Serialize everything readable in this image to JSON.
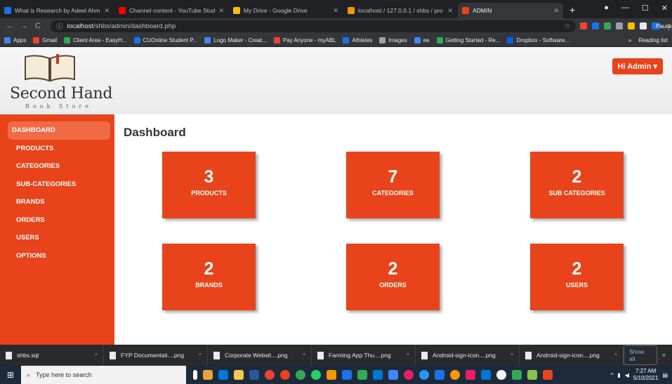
{
  "browser": {
    "tabs": [
      {
        "label": "What is Research by Adeel Ahm",
        "color": "#1a73e8"
      },
      {
        "label": "Channel content - YouTube Stud",
        "color": "#ff0000"
      },
      {
        "label": "My Drive - Google Drive",
        "color": "#fbbc04"
      },
      {
        "label": "localhost / 127.0.0.1 / shbs / pro",
        "color": "#f29900"
      },
      {
        "label": "ADMIN",
        "color": "#e8431a",
        "active": true
      }
    ],
    "new_tab": "+",
    "url_host": "localhost",
    "url_path": "/shbs/admin/dashboard.php",
    "profile_status": "Paused",
    "bookmarks": [
      {
        "label": "Apps",
        "color": "#4285f4"
      },
      {
        "label": "Gmail",
        "color": "#ea4335"
      },
      {
        "label": "Client Area - EasyH...",
        "color": "#34a853"
      },
      {
        "label": "CUOnline Student P...",
        "color": "#1a73e8"
      },
      {
        "label": "Logo Maker - Creat...",
        "color": "#4285f4"
      },
      {
        "label": "Pay Anyone - myABL",
        "color": "#ea4335"
      },
      {
        "label": "Athletes",
        "color": "#1a73e8"
      },
      {
        "label": "Images",
        "color": "#9aa0a6"
      },
      {
        "label": "ee",
        "color": "#4285f4"
      },
      {
        "label": "Getting Started - Re...",
        "color": "#34a853"
      },
      {
        "label": "Dropbox - Software...",
        "color": "#0061ff"
      }
    ],
    "bookmarks_more": "»",
    "reading_list": "Reading list"
  },
  "site": {
    "logo_title": "Second Hand",
    "logo_subtitle": "Book Store",
    "admin_button": "Hi Admin ▾",
    "accent": "#e8431a"
  },
  "sidebar": {
    "items": [
      {
        "label": "DASHBOARD",
        "active": true
      },
      {
        "label": "PRODUCTS"
      },
      {
        "label": "CATEGORIES"
      },
      {
        "label": "SUB-CATEGORIES"
      },
      {
        "label": "BRANDS"
      },
      {
        "label": "ORDERS"
      },
      {
        "label": "USERS"
      },
      {
        "label": "OPTIONS"
      }
    ]
  },
  "main": {
    "title": "Dashboard",
    "cards": [
      {
        "count": "3",
        "label": "PRODUCTS"
      },
      {
        "count": "7",
        "label": "CATEGORIES"
      },
      {
        "count": "2",
        "label": "SUB CATEGORIES"
      },
      {
        "count": "2",
        "label": "BRANDS"
      },
      {
        "count": "2",
        "label": "ORDERS"
      },
      {
        "count": "2",
        "label": "USERS"
      }
    ]
  },
  "downloads": {
    "items": [
      {
        "name": "shbs.sql"
      },
      {
        "name": "FYP Documentati....png"
      },
      {
        "name": "Corporate Websit....png"
      },
      {
        "name": "Farming App Thu....png"
      },
      {
        "name": "Android-sign-icon....png"
      },
      {
        "name": "Android-sign-icon....png"
      }
    ],
    "show_all": "Show all"
  },
  "taskbar": {
    "search_placeholder": "Type here to search",
    "time": "7:27 AM",
    "date": "5/10/2021"
  }
}
